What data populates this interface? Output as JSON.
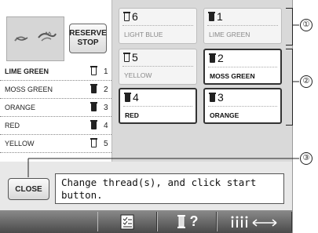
{
  "reserve_button": {
    "line1": "RESERVE",
    "line2": "STOP"
  },
  "thread_list": [
    {
      "name": "LIME GREEN",
      "spool": "empty",
      "num": "1",
      "current": true
    },
    {
      "name": "MOSS GREEN",
      "spool": "full",
      "num": "2",
      "current": false
    },
    {
      "name": "ORANGE",
      "spool": "full",
      "num": "3",
      "current": false
    },
    {
      "name": "RED",
      "spool": "full",
      "num": "4",
      "current": false
    },
    {
      "name": "YELLOW",
      "spool": "empty",
      "num": "5",
      "current": false
    }
  ],
  "needle_slots": [
    {
      "num": "6",
      "label": "LIGHT BLUE",
      "spool": "empty",
      "swap": false
    },
    {
      "num": "1",
      "label": "LIME GREEN",
      "spool": "full",
      "swap": false
    },
    {
      "num": "5",
      "label": "YELLOW",
      "spool": "empty",
      "swap": false
    },
    {
      "num": "2",
      "label": "MOSS GREEN",
      "spool": "full",
      "swap": true
    },
    {
      "num": "4",
      "label": "RED",
      "spool": "full",
      "swap": true
    },
    {
      "num": "3",
      "label": "ORANGE",
      "spool": "full",
      "swap": true
    }
  ],
  "callouts": [
    "①",
    "②",
    "③"
  ],
  "close_button": "CLOSE",
  "message_line1": "Change thread(s), and click start",
  "message_line2": "button.",
  "bottom_bar": {
    "icons": [
      "checklist-icon",
      "thread-help-icon",
      "needle-bar-move-icon"
    ],
    "help_mark": "?"
  }
}
